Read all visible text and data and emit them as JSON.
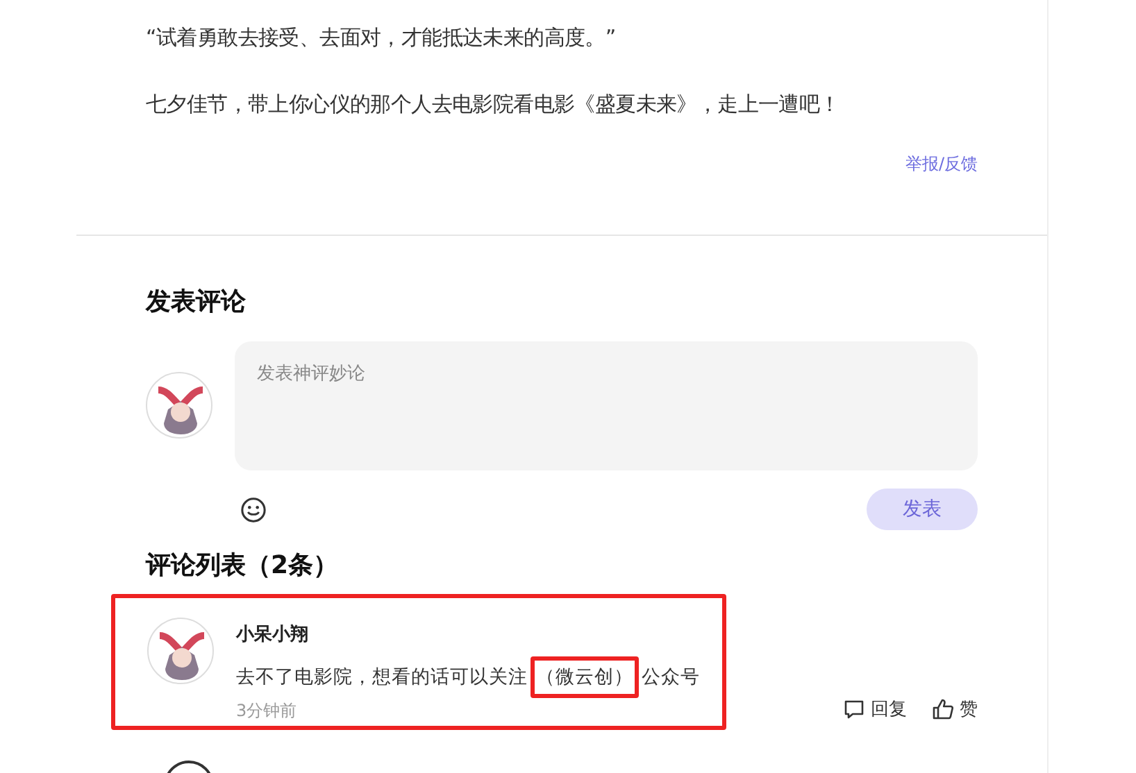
{
  "article": {
    "paragraphs": [
      "“试着勇敢去接受、去面对，才能抵达未来的高度。”",
      "七夕佳节，带上你心仪的那个人去电影院看电影《盛夏未来》，走上一遭吧！"
    ],
    "report_link": "举报/反馈"
  },
  "comment_form": {
    "title": "发表评论",
    "placeholder": "发表神评妙论",
    "submit": "发表",
    "submit_disabled": true
  },
  "comment_list": {
    "title": "评论列表（2条）",
    "comments": [
      {
        "author": "小呆小翔",
        "text_before": "去不了电影院，想看的话可以关注",
        "text_highlight": "（微云创）",
        "text_after": "公众号",
        "time": "3分钟前",
        "reply": "回复",
        "like": "赞",
        "highlighted": true
      }
    ]
  }
}
